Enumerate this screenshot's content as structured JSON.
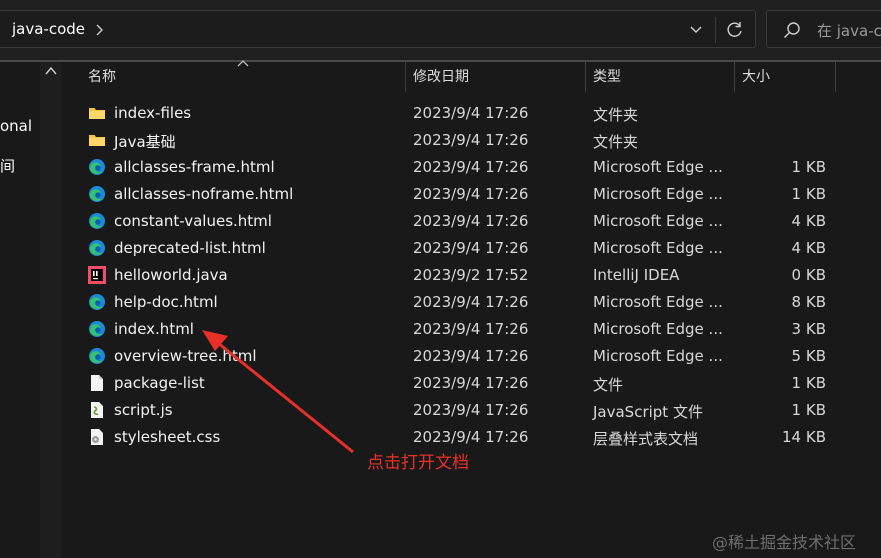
{
  "address_bar": {
    "path": "java-code"
  },
  "search": {
    "placeholder": "在 java-co"
  },
  "nav_pane": {
    "items": [
      "onal",
      "间"
    ]
  },
  "columns": {
    "name": "名称",
    "date": "修改日期",
    "type": "类型",
    "size": "大小"
  },
  "files": [
    {
      "name": "index-files",
      "date": "2023/9/4 17:26",
      "type": "文件夹",
      "size": "",
      "icon": "folder-icon"
    },
    {
      "name": "Java基础",
      "date": "2023/9/4 17:26",
      "type": "文件夹",
      "size": "",
      "icon": "folder-icon"
    },
    {
      "name": "allclasses-frame.html",
      "date": "2023/9/4 17:26",
      "type": "Microsoft Edge ...",
      "size": "1 KB",
      "icon": "edge-icon"
    },
    {
      "name": "allclasses-noframe.html",
      "date": "2023/9/4 17:26",
      "type": "Microsoft Edge ...",
      "size": "1 KB",
      "icon": "edge-icon"
    },
    {
      "name": "constant-values.html",
      "date": "2023/9/4 17:26",
      "type": "Microsoft Edge ...",
      "size": "4 KB",
      "icon": "edge-icon"
    },
    {
      "name": "deprecated-list.html",
      "date": "2023/9/4 17:26",
      "type": "Microsoft Edge ...",
      "size": "4 KB",
      "icon": "edge-icon"
    },
    {
      "name": "helloworld.java",
      "date": "2023/9/2 17:52",
      "type": "IntelliJ IDEA",
      "size": "0 KB",
      "icon": "intellij-icon"
    },
    {
      "name": "help-doc.html",
      "date": "2023/9/4 17:26",
      "type": "Microsoft Edge ...",
      "size": "8 KB",
      "icon": "edge-icon"
    },
    {
      "name": "index.html",
      "date": "2023/9/4 17:26",
      "type": "Microsoft Edge ...",
      "size": "3 KB",
      "icon": "edge-icon"
    },
    {
      "name": "overview-tree.html",
      "date": "2023/9/4 17:26",
      "type": "Microsoft Edge ...",
      "size": "5 KB",
      "icon": "edge-icon"
    },
    {
      "name": "package-list",
      "date": "2023/9/4 17:26",
      "type": "文件",
      "size": "1 KB",
      "icon": "file-icon"
    },
    {
      "name": "script.js",
      "date": "2023/9/4 17:26",
      "type": "JavaScript 文件",
      "size": "1 KB",
      "icon": "js-file-icon"
    },
    {
      "name": "stylesheet.css",
      "date": "2023/9/4 17:26",
      "type": "层叠样式表文档",
      "size": "14 KB",
      "icon": "css-file-icon"
    }
  ],
  "annotation": {
    "text": "点击打开文档",
    "color": "#e8302a"
  },
  "watermark": "@稀土掘金技术社区",
  "colors": {
    "background": "#191919",
    "folder": "#f6c445",
    "edge_blue": "#1b8ad8",
    "edge_green": "#36c36b"
  }
}
